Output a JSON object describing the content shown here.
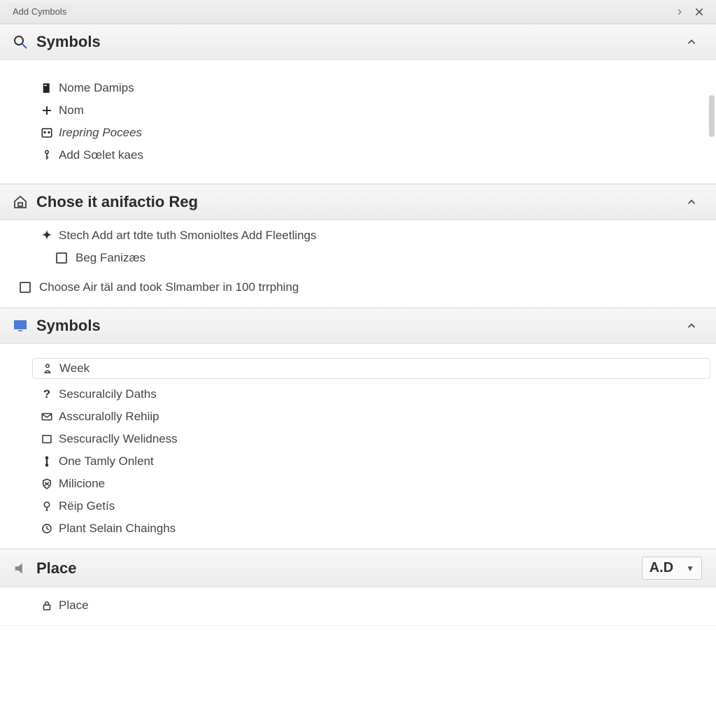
{
  "window": {
    "title": "Add Cymbols"
  },
  "sections": {
    "symbols1": {
      "title": "Symbols",
      "items": [
        {
          "label": "Nome Damips"
        },
        {
          "label": "Nom"
        },
        {
          "label": "Irepring Pocees"
        },
        {
          "label": "Add Sœlet kaes"
        }
      ]
    },
    "choose": {
      "title": "Chose it anifactio Reg",
      "line1": "Stech Add art tdte tuth Smonioltes Add Fleetlings",
      "check1": "Beg Fanizæs",
      "check2": "Choose Air täl and took Slmamber in 100 trrphing"
    },
    "symbols2": {
      "title": "Symbols",
      "items": [
        {
          "label": "Week"
        },
        {
          "label": "Sescuralcily Daths"
        },
        {
          "label": "Asscuralolly Rehiip"
        },
        {
          "label": "Sescuraclly Welidness"
        },
        {
          "label": "One Tamly Onlent"
        },
        {
          "label": "Milicione"
        },
        {
          "label": "Rëip Getís"
        },
        {
          "label": "Plant Selain Chainghs"
        }
      ]
    },
    "place": {
      "title": "Place",
      "dropdown": "A.D",
      "items": [
        {
          "label": "Place"
        }
      ]
    }
  }
}
